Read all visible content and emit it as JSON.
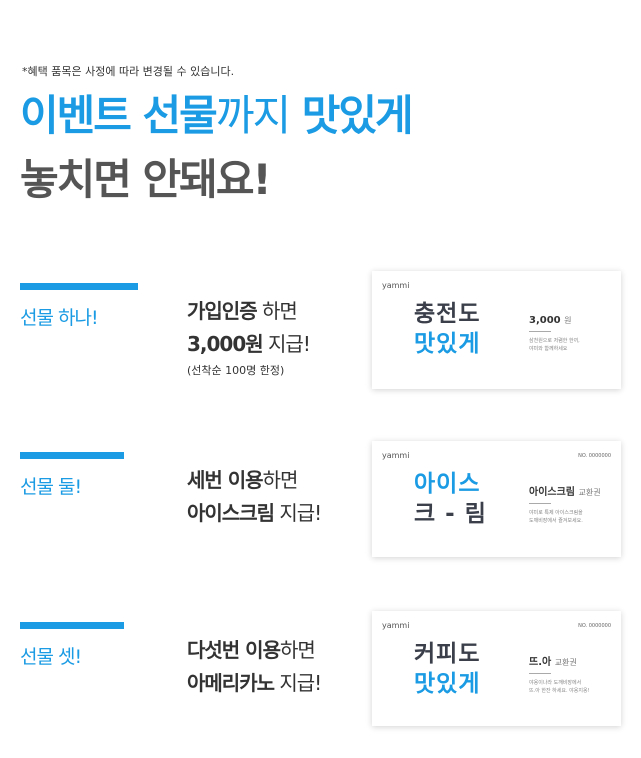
{
  "notice": "*혜택 품목은 사정에 따라 변경될 수 있습니다.",
  "title": {
    "line1_a": "이벤트 선물",
    "line1_b": "까지",
    "line1_c": " 맛있게",
    "line2": "놓치면 안돼요!"
  },
  "sections": [
    {
      "label": "선물 하나!",
      "desc_bold1": "가입인증",
      "desc_1": " 하면",
      "desc_bold2": "3,000원",
      "desc_2": " 지급!",
      "note": "(선착순 100명 한정)",
      "card": {
        "logo": "yammi",
        "big1": "충전도",
        "big2": "맛있게",
        "head": "3,000",
        "head_unit": "원",
        "small1": "삼천원으로 저렴한 한끼,",
        "small2": "야미와 함께하세요"
      }
    },
    {
      "label": "선물 둘!",
      "desc_bold1": "세번 이용",
      "desc_1": "하면",
      "desc_bold2": "아이스크림",
      "desc_2": " 지급!",
      "card": {
        "logo": "yammi",
        "no": "NO. 0000000",
        "big1": "아이스",
        "big2": "크 - 림",
        "head": "아이스크림",
        "head_unit": "교환권",
        "small1": "야미로 특제 아이스크림을",
        "small2": "도깨비장에서 즐겨보세요."
      }
    },
    {
      "label": "선물 셋!",
      "desc_bold1": "다섯번 이용",
      "desc_1": "하면",
      "desc_bold2": "아메리카노",
      "desc_2": " 지급!",
      "card": {
        "logo": "yammi",
        "no": "NO. 0000000",
        "big1": "커피도",
        "big2": "맛있게",
        "head": "뜨.아",
        "head_unit": "교환권",
        "small1": "야옹이나라 도깨비장에서",
        "small2": "뜨.아 한잔 하세요. 야옹지옹!"
      }
    }
  ]
}
